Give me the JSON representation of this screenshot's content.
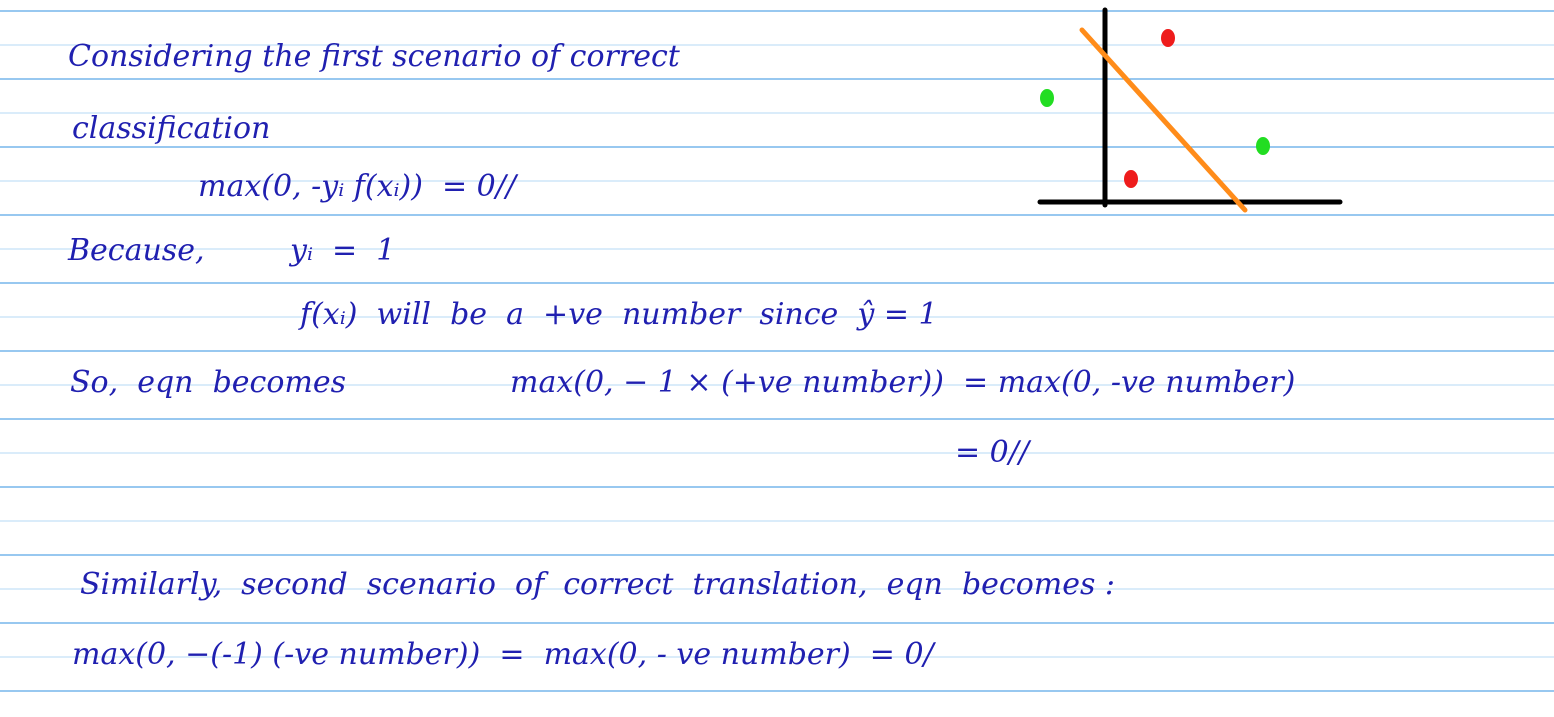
{
  "lines": {
    "l1": "Considering the first scenario of correct",
    "l2": "classification",
    "l3": "max(0, -yᵢ f(xᵢ))  = 0//",
    "l4a": "Because,",
    "l4b": "yᵢ  =  1",
    "l5": "f(xᵢ)  will  be  a  +ve  number  since  ŷ = 1",
    "l6a": "So,  eqn  becomes",
    "l6b": "max(0, − 1 × (+ve number))  = max(0, -ve number)",
    "l7": "= 0//",
    "l8": "Similarly,  second  scenario  of  correct  translation,  eqn  becomes :",
    "l9": "max(0, −(-1) (-ve number))  =  max(0, - ve number)  = 0/"
  },
  "colors": {
    "ink": "#2020b0",
    "rule": "#5aa6e6",
    "axes": "#000000",
    "boundary": "#ff8c1a",
    "red_point": "#ee1c1c",
    "green_point": "#22dd22"
  }
}
